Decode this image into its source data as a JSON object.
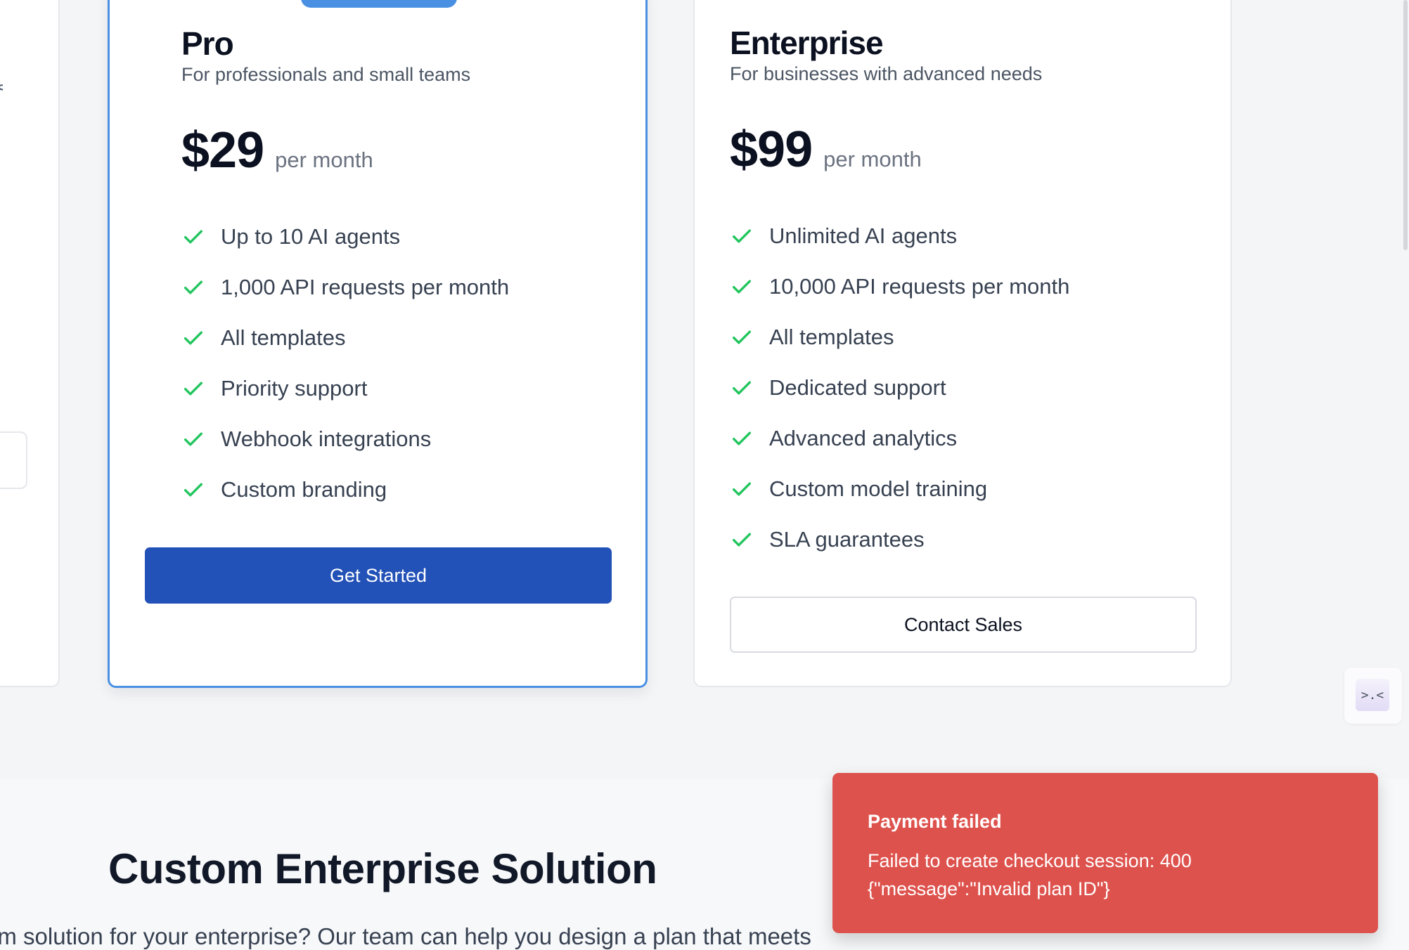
{
  "plans": {
    "pro": {
      "name": "Pro",
      "description": "For professionals and small teams",
      "price": "$29",
      "period": "per month",
      "features": [
        "Up to 10 AI agents",
        "1,000 API requests per month",
        "All templates",
        "Priority support",
        "Webhook integrations",
        "Custom branding"
      ],
      "cta": "Get Started"
    },
    "enterprise": {
      "name": "Enterprise",
      "description": "For businesses with advanced needs",
      "price": "$99",
      "period": "per month",
      "features": [
        "Unlimited AI agents",
        "10,000 API requests per month",
        "All templates",
        "Dedicated support",
        "Advanced analytics",
        "Custom model training",
        "SLA guarantees"
      ],
      "cta": "Contact Sales"
    }
  },
  "custom_section": {
    "title": "Custom Enterprise Solution",
    "body": "om solution for your enterprise? Our team can help you design a plan that meets"
  },
  "toast": {
    "title": "Payment failed",
    "message": "Failed to create checkout session: 400\n{\"message\":\"Invalid plan ID\"}"
  },
  "widget": {
    "glyph": ">.<"
  },
  "colors": {
    "accent": "#4a90e2",
    "primary_button": "#2251b7",
    "check": "#22c55e",
    "toast_bg": "#de524d"
  },
  "icons": {
    "feature": "check-icon"
  }
}
